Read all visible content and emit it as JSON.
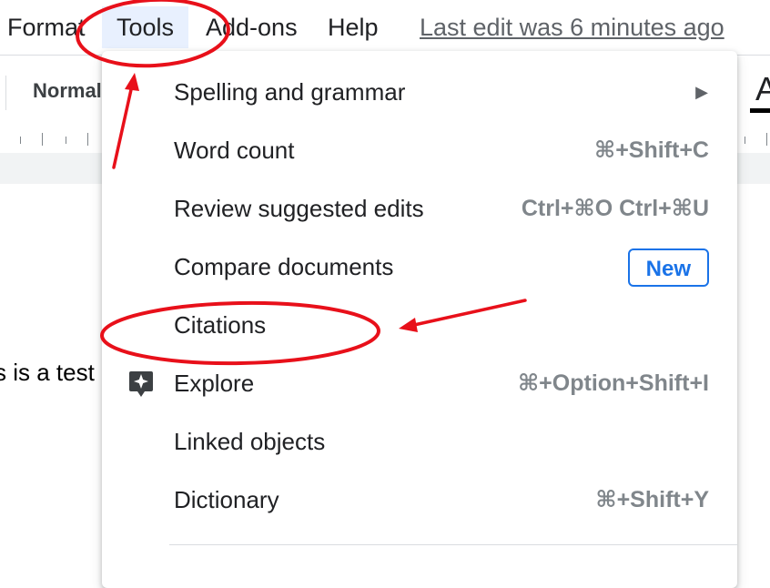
{
  "menubar": {
    "items": [
      "Format",
      "Tools",
      "Add-ons",
      "Help"
    ],
    "last_edit": "Last edit was 6 minutes ago"
  },
  "toolbar": {
    "style_value": "Normal",
    "font_glyph": "A"
  },
  "document": {
    "text": "s is a test"
  },
  "menu": {
    "items": [
      {
        "label": "Spelling and grammar",
        "submenu": true
      },
      {
        "label": "Word count",
        "shortcut": "⌘+Shift+C"
      },
      {
        "label": "Review suggested edits",
        "shortcut": "Ctrl+⌘O Ctrl+⌘U"
      },
      {
        "label": "Compare documents",
        "badge": "New"
      },
      {
        "label": "Citations"
      },
      {
        "label": "Explore",
        "shortcut": "⌘+Option+Shift+I",
        "icon": "explore-icon"
      },
      {
        "label": "Linked objects"
      },
      {
        "label": "Dictionary",
        "shortcut": "⌘+Shift+Y"
      }
    ],
    "submenu_arrow": "▶"
  },
  "colors": {
    "accent": "#1a73e8",
    "annotation": "#e8101a",
    "selected_menu_bg": "#e8f0fe"
  }
}
